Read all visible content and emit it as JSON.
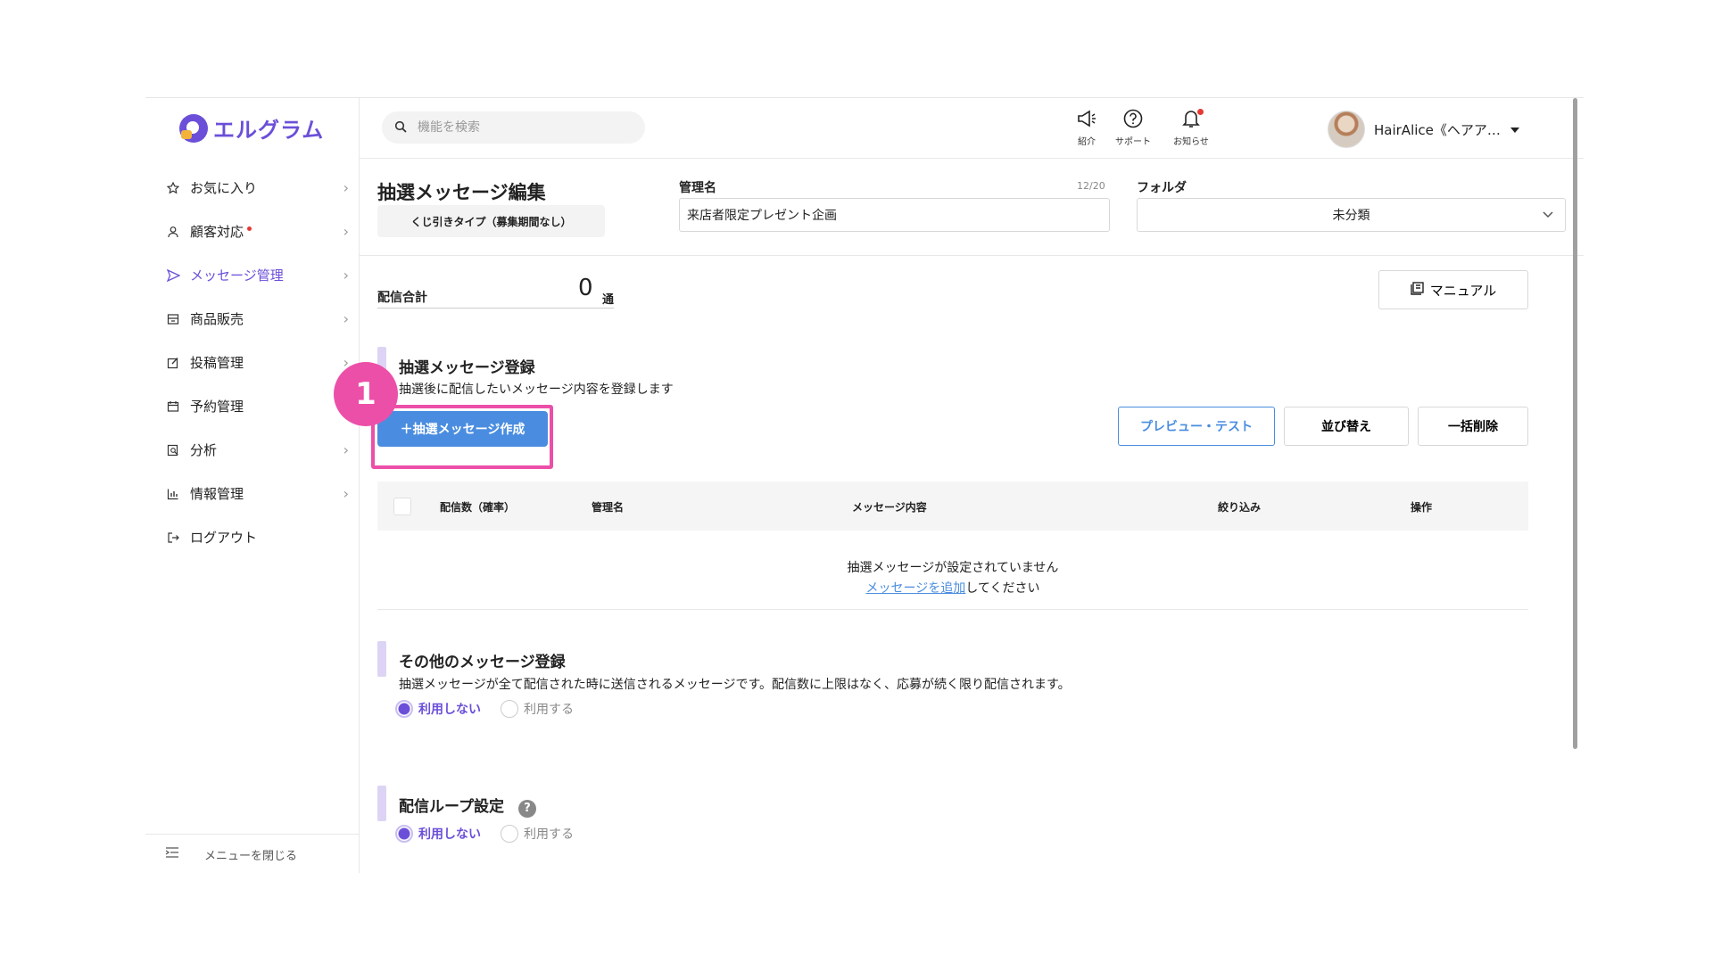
{
  "app": {
    "logo_text": "エルグラム",
    "brand_color": "#6b4fd8"
  },
  "sidebar": {
    "items": [
      {
        "label": "お気に入り",
        "icon": "star-icon"
      },
      {
        "label": "顧客対応",
        "icon": "person-icon"
      },
      {
        "label": "メッセージ管理",
        "icon": "send-icon"
      },
      {
        "label": "商品販売",
        "icon": "store-icon"
      },
      {
        "label": "投稿管理",
        "icon": "edit-icon"
      },
      {
        "label": "予約管理",
        "icon": "calendar-icon"
      },
      {
        "label": "分析",
        "icon": "analysis-icon"
      },
      {
        "label": "情報管理",
        "icon": "chart-icon"
      },
      {
        "label": "ログアウト",
        "icon": "logout-icon"
      }
    ],
    "active_item": "メッセージ管理",
    "close_menu_label": "メニューを閉じる"
  },
  "topbar": {
    "search_placeholder": "機能を検索",
    "icons": {
      "intro": "紹介",
      "support": "サポート",
      "notice": "お知らせ"
    },
    "user_name": "HairAlice《ヘアア…"
  },
  "editor": {
    "page_title": "抽選メッセージ編集",
    "type_chip": "くじ引きタイプ（募集期間なし）",
    "name_label": "管理名",
    "name_counter": "12/20",
    "name_value": "来店者限定プレゼント企画",
    "folder_label": "フォルダ",
    "folder_value": "未分類",
    "total_label": "配信合計",
    "total_value": "0",
    "total_unit": "通",
    "manual_label": "マニュアル"
  },
  "lottery_section": {
    "title": "抽選メッセージ登録",
    "desc": "抽選後に配信したいメッセージ内容を登録します",
    "create_button": "＋抽選メッセージ作成",
    "step_number": "1",
    "preview_button": "プレビュー・テスト",
    "sort_button": "並び替え",
    "bulk_delete_button": "一括削除",
    "columns": [
      "配信数（確率）",
      "管理名",
      "メッセージ内容",
      "絞り込み",
      "操作"
    ],
    "empty_text": "抽選メッセージが設定されていません",
    "empty_link": "メッセージを追加",
    "empty_suffix": "してください"
  },
  "other_section": {
    "title": "その他のメッセージ登録",
    "desc": "抽選メッセージが全て配信された時に送信されるメッセージです。配信数に上限はなく、応募が続く限り配信されます。",
    "option_off": "利用しない",
    "option_on": "利用する"
  },
  "loop_section": {
    "title": "配信ループ設定",
    "help": "?",
    "option_off": "利用しない",
    "option_on": "利用する"
  },
  "colors": {
    "accent_pink": "#ec4fa8",
    "button_blue": "#4a8de0",
    "section_bar": "#ddd4f5"
  }
}
